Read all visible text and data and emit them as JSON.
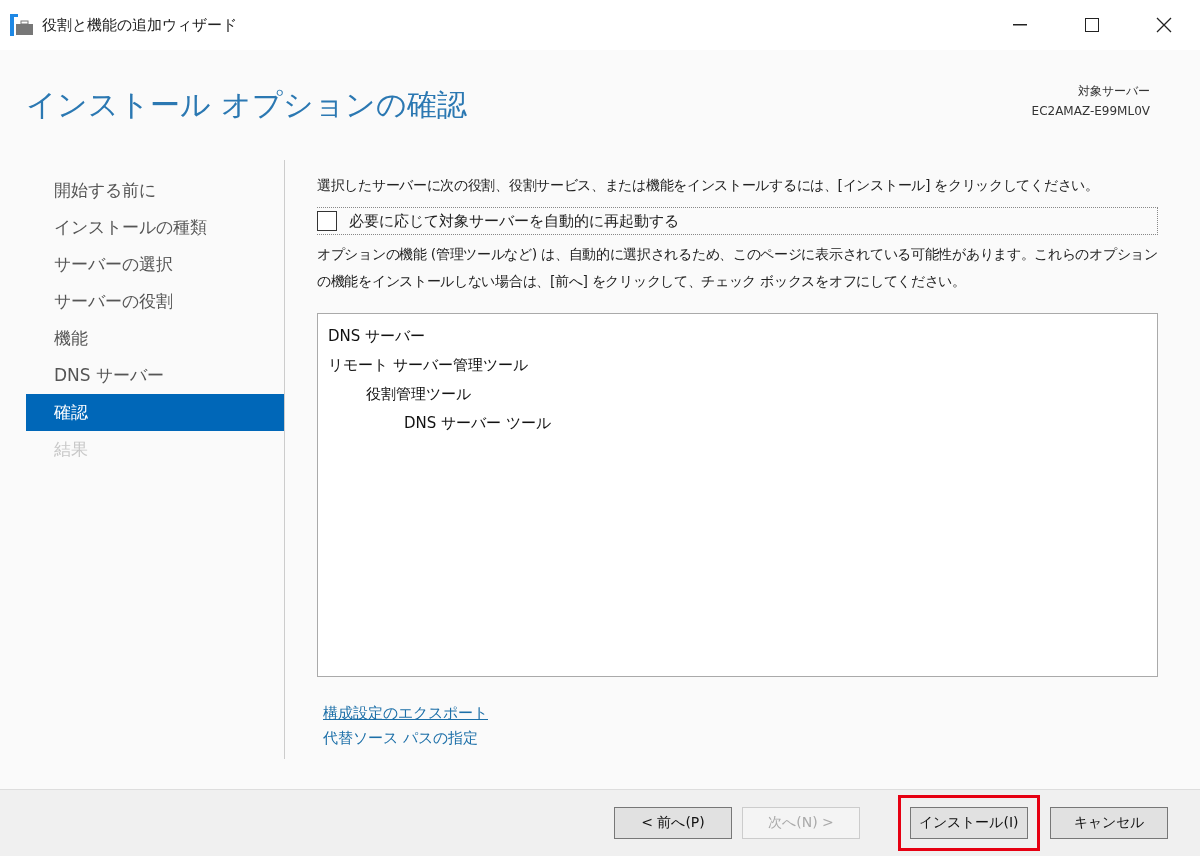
{
  "window": {
    "title": "役割と機能の追加ウィザード"
  },
  "header": {
    "title": "インストール オプションの確認",
    "server_label": "対象サーバー",
    "server_name": "EC2AMAZ-E99ML0V"
  },
  "sidebar": {
    "items": [
      {
        "label": "開始する前に",
        "selected": false,
        "disabled": false
      },
      {
        "label": "インストールの種類",
        "selected": false,
        "disabled": false
      },
      {
        "label": "サーバーの選択",
        "selected": false,
        "disabled": false
      },
      {
        "label": "サーバーの役割",
        "selected": false,
        "disabled": false
      },
      {
        "label": "機能",
        "selected": false,
        "disabled": false
      },
      {
        "label": "DNS サーバー",
        "selected": false,
        "disabled": false
      },
      {
        "label": "確認",
        "selected": true,
        "disabled": false
      },
      {
        "label": "結果",
        "selected": false,
        "disabled": true
      }
    ]
  },
  "content": {
    "instruction": "選択したサーバーに次の役割、役割サービス、または機能をインストールするには、[インストール] をクリックしてください。",
    "restart": {
      "label": "必要に応じて対象サーバーを自動的に再起動する",
      "checked": false
    },
    "note": "オプションの機能 (管理ツールなど) は、自動的に選択されるため、このページに表示されている可能性があります。これらのオプションの機能をインストールしない場合は、[前へ] をクリックして、チェック ボックスをオフにしてください。",
    "features": [
      {
        "label": "DNS サーバー"
      },
      {
        "label": "リモート サーバー管理ツール",
        "children": [
          {
            "label": "役割管理ツール",
            "children": [
              {
                "label": "DNS サーバー ツール"
              }
            ]
          }
        ]
      }
    ],
    "links": [
      {
        "label": "構成設定のエクスポート",
        "underlined": true
      },
      {
        "label": "代替ソース パスの指定",
        "underlined": false
      }
    ]
  },
  "buttons": [
    {
      "label": "< 前へ(P)",
      "disabled": false,
      "highlighted": false
    },
    {
      "label": "次へ(N) >",
      "disabled": true,
      "highlighted": false
    },
    {
      "label": "インストール(I)",
      "disabled": false,
      "highlighted": true
    },
    {
      "label": "キャンセル",
      "disabled": false,
      "highlighted": false
    }
  ]
}
